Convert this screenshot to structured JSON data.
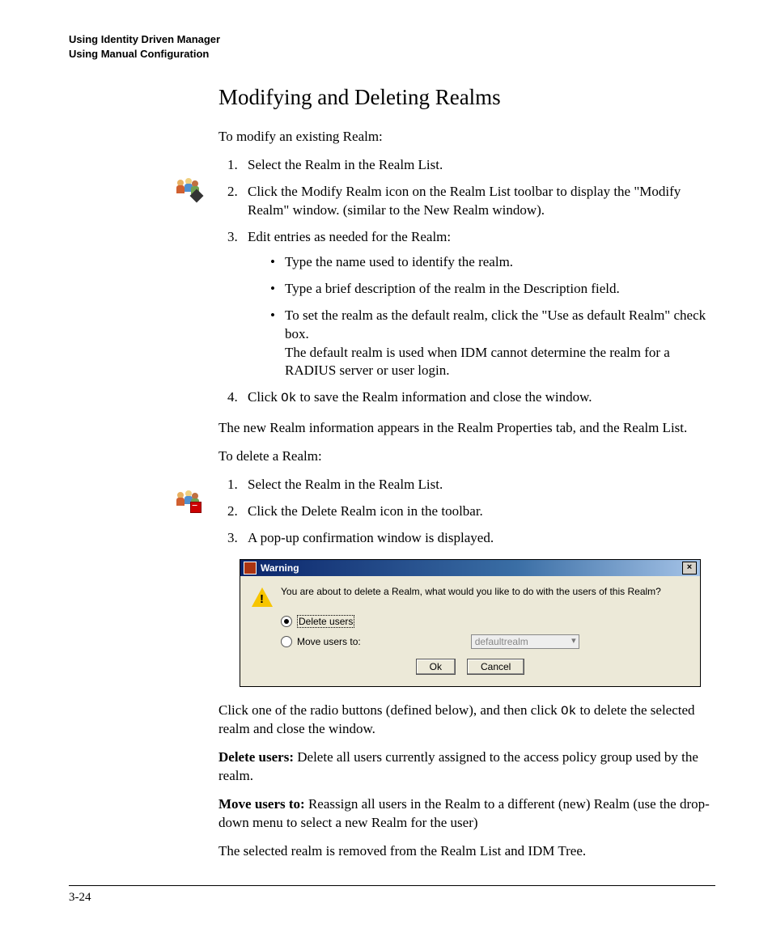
{
  "header": {
    "line1": "Using Identity Driven Manager",
    "line2": "Using Manual Configuration"
  },
  "title": "Modifying and Deleting Realms",
  "intro_modify": "To modify an existing Realm:",
  "steps_modify": {
    "s1": "Select the Realm in the Realm List.",
    "s2": "Click the Modify Realm icon on the Realm List toolbar to display the \"Modify Realm\" window. (similar to the New Realm window).",
    "s3": "Edit entries as needed for the Realm:",
    "s3_b1": "Type the name used to identify the realm.",
    "s3_b2": "Type a brief description of the realm in the Description field.",
    "s3_b3a": "To set the realm as the default realm, click the \"Use as default Realm\" check box.",
    "s3_b3b": "The default realm is used when IDM cannot determine the realm for a RADIUS server or user login.",
    "s4_pre": "Click ",
    "s4_code": "Ok",
    "s4_post": " to save the Realm information and close the window."
  },
  "after_modify": "The new Realm information appears in the Realm Properties tab, and the Realm List.",
  "intro_delete": "To delete a Realm:",
  "steps_delete": {
    "s1": "Select the Realm in the Realm List.",
    "s2": "Click the Delete Realm icon in the toolbar.",
    "s3": "A pop-up confirmation window is displayed."
  },
  "dialog": {
    "title": "Warning",
    "message": "You are about to delete a Realm, what would you like to do with the users of this Realm?",
    "opt1": "Delete users",
    "opt2": "Move users to:",
    "select_value": "defaultrealm",
    "ok": "Ok",
    "cancel": "Cancel"
  },
  "after_dialog": {
    "p1_pre": "Click one of the radio buttons (defined below), and then click ",
    "p1_code": "Ok",
    "p1_post": " to delete the selected realm and close the window.",
    "del_label": "Delete users:",
    "del_text": " Delete all users currently assigned to the access policy group used by the realm.",
    "move_label": "Move users to:",
    "move_text": " Reassign all users in the Realm to a different (new) Realm (use the drop-down menu to select a new Realm for the user)",
    "final": "The selected realm is removed from the Realm List and IDM Tree."
  },
  "page_number": "3-24"
}
